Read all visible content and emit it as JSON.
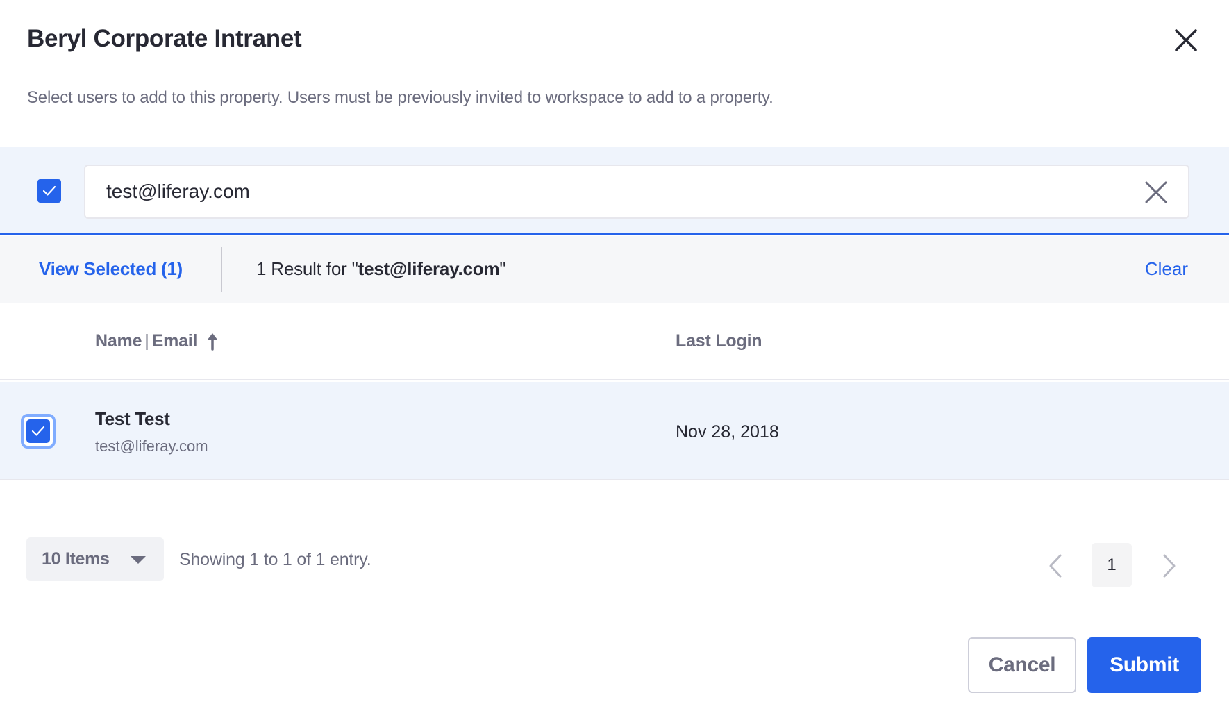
{
  "modal": {
    "title": "Beryl Corporate Intranet",
    "description": "Select users to add to this property. Users must be previously invited to workspace to add to a property.",
    "close_icon": "close-icon"
  },
  "search": {
    "select_all_checked": true,
    "value": "test@liferay.com",
    "placeholder": "",
    "clear_icon": "close-icon"
  },
  "results_bar": {
    "view_selected_label": "View Selected (1)",
    "results_prefix": "1 Result for \"",
    "results_query": "test@liferay.com",
    "results_suffix": "\"",
    "clear_label": "Clear"
  },
  "table": {
    "columns": [
      {
        "label_a": "Name",
        "separator": "|",
        "label_b": "Email",
        "sort": "ascending",
        "sort_icon": "arrow-up-icon"
      },
      {
        "label": "Last Login"
      }
    ],
    "rows": [
      {
        "selected": true,
        "name": "Test Test",
        "email": "test@liferay.com",
        "last_login": "Nov 28, 2018"
      }
    ]
  },
  "pagination": {
    "items_per_page_label": "10 Items",
    "showing_text": "Showing 1 to 1 of 1 entry.",
    "current_page": "1",
    "prev_icon": "chevron-left-icon",
    "next_icon": "chevron-right-icon"
  },
  "actions": {
    "cancel_label": "Cancel",
    "submit_label": "Submit"
  },
  "colors": {
    "primary": "#2563eb",
    "text": "#272833",
    "muted": "#6b6c7e",
    "search_band_bg": "#eff4fc",
    "results_bar_bg": "#f6f7f9"
  }
}
